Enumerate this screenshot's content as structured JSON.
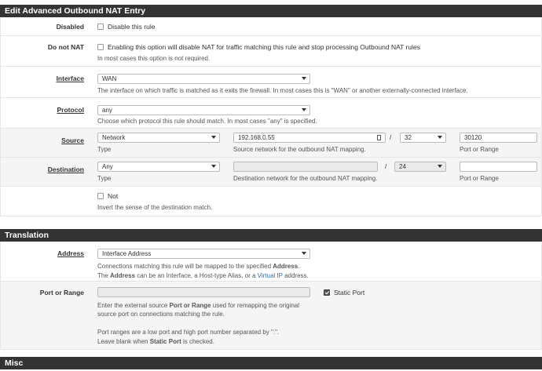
{
  "edit_section": {
    "title": "Edit Advanced Outbound NAT Entry",
    "disabled": {
      "label": "Disabled",
      "checkbox_label": "Disable this rule",
      "checked": false
    },
    "do_not_nat": {
      "label": "Do not NAT",
      "checkbox_label": "Enabling this option will disable NAT for traffic matching this rule and stop processing Outbound NAT rules",
      "help": "In most cases this option is not required.",
      "checked": false
    },
    "interface": {
      "label": "Interface",
      "value": "WAN",
      "help": "The interface on which traffic is matched as it exits the firewall. In most cases this is \"WAN\" or another externally-connected interface."
    },
    "protocol": {
      "label": "Protocol",
      "value": "any",
      "help": "Choose which protocol this rule should match. In most cases \"any\" is specified."
    },
    "source": {
      "label": "Source",
      "type_value": "Network",
      "type_help": "Type",
      "address_value": "192.168.0.55",
      "address_help": "Source network for the outbound NAT mapping.",
      "slash": "/",
      "mask_value": "32",
      "port_value": "30120",
      "port_help": "Port or Range"
    },
    "destination": {
      "label": "Destination",
      "type_value": "Any",
      "type_help": "Type",
      "address_value": "",
      "address_help": "Destination network for the outbound NAT mapping.",
      "slash": "/",
      "mask_value": "24",
      "port_value": "",
      "port_help": "Port or Range"
    },
    "not_option": {
      "checkbox_label": "Not",
      "help": "Invert the sense of the destination match.",
      "checked": false
    }
  },
  "translation_section": {
    "title": "Translation",
    "address": {
      "label": "Address",
      "value": "Interface Address",
      "help_line1_prefix": "Connections matching this rule will be mapped to the specified ",
      "help_line1_bold": "Address",
      "help_line1_suffix": ".",
      "help_line2_prefix": "The ",
      "help_line2_bold": "Address",
      "help_line2_mid": " can be an Interface, a Host-type Alias, or a ",
      "help_line2_link": "Virtual IP",
      "help_line2_suffix": " address."
    },
    "port_or_range": {
      "label": "Port or Range",
      "value": "",
      "static_port_label": "Static Port",
      "static_port_checked": true,
      "help_line1_prefix": "Enter the external source ",
      "help_line1_bold1": "Port or Range",
      "help_line1_suffix": " used for remapping the original",
      "help_line2": "source port on connections matching the rule.",
      "help_line3": "Port ranges are a low port and high port number separated by \":\".",
      "help_line4_prefix": "Leave blank when ",
      "help_line4_bold": "Static Port",
      "help_line4_suffix": " is checked."
    }
  },
  "misc_section": {
    "title": "Misc"
  }
}
